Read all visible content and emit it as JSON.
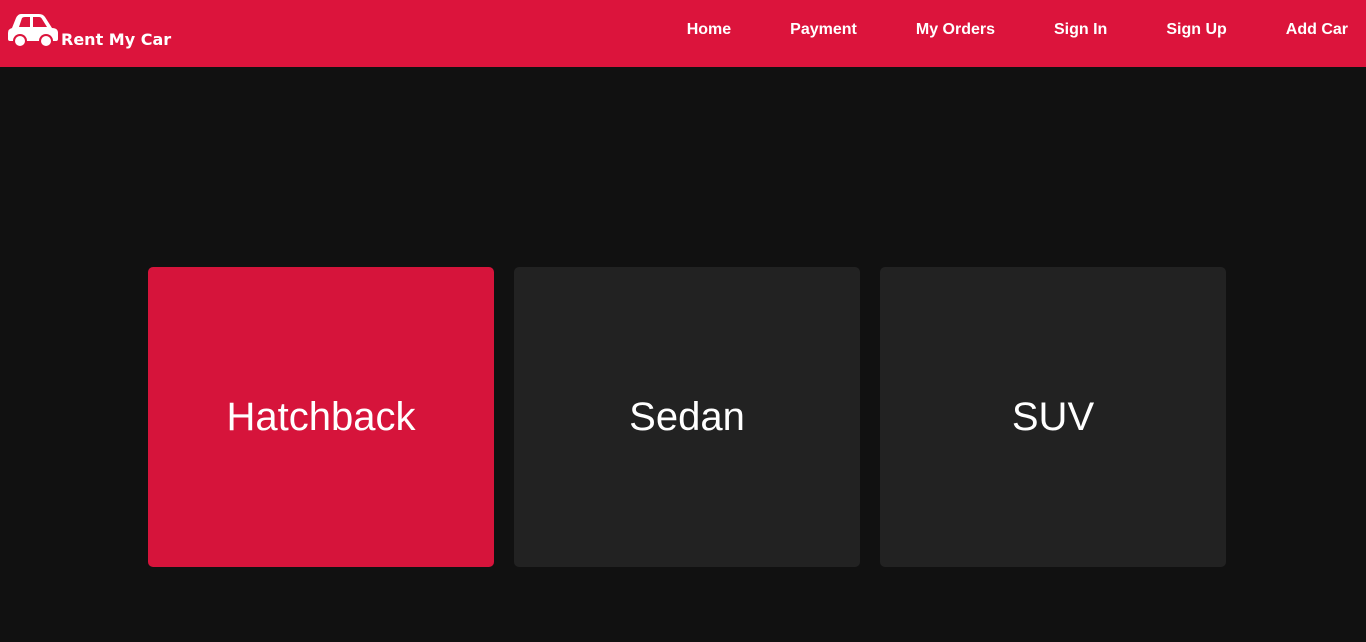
{
  "brand": {
    "name": "Rent My Car",
    "icon": "car-icon"
  },
  "nav": {
    "items": [
      "Home",
      "Payment",
      "My Orders",
      "Sign In",
      "Sign Up",
      "Add Car"
    ]
  },
  "categories": [
    {
      "label": "Hatchback",
      "active": true
    },
    {
      "label": "Sedan",
      "active": false
    },
    {
      "label": "SUV",
      "active": false
    }
  ],
  "colors": {
    "navbar": "#dc143c",
    "background": "#111111",
    "card": "#222222",
    "card_active": "#d6143b",
    "text": "#ffffff"
  }
}
